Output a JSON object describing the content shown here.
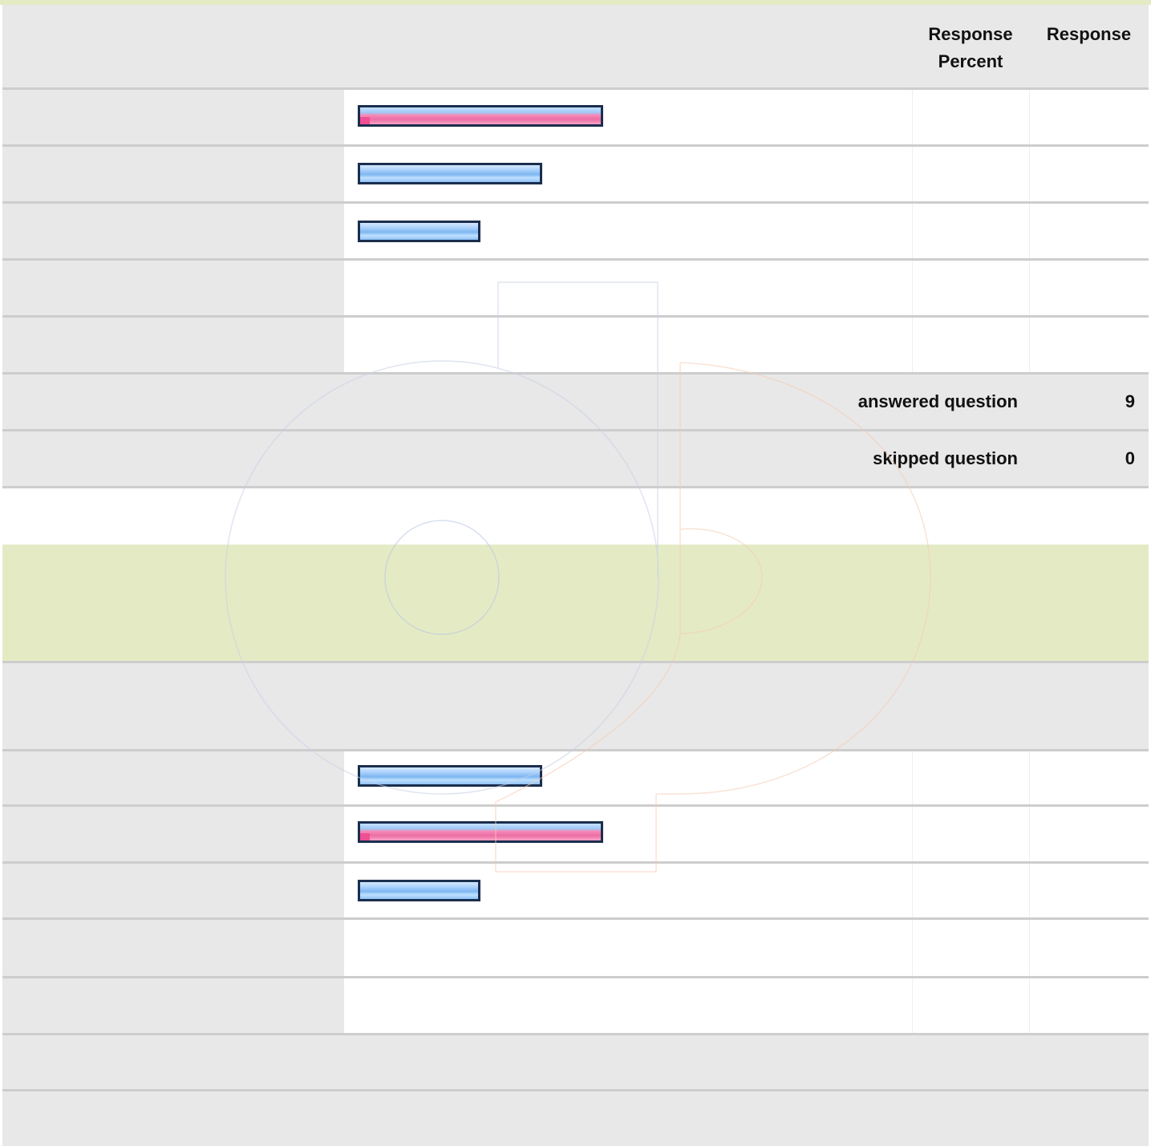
{
  "table1": {
    "header": {
      "response_percent": "Response Percent",
      "response_count": "Response"
    },
    "bars": [
      {
        "percent": 44.4,
        "style": "pink"
      },
      {
        "percent": 33.3,
        "style": "blue"
      },
      {
        "percent": 22.2,
        "style": "blue"
      },
      {
        "percent": 0,
        "style": "none"
      },
      {
        "percent": 0,
        "style": "none"
      }
    ],
    "summary": {
      "answered_label": "answered question",
      "answered_value": "9",
      "skipped_label": "skipped question",
      "skipped_value": "0"
    }
  },
  "table2": {
    "bars": [
      {
        "percent": 33.3,
        "style": "blue"
      },
      {
        "percent": 44.4,
        "style": "pink"
      },
      {
        "percent": 22.2,
        "style": "blue"
      },
      {
        "percent": 0,
        "style": "none"
      },
      {
        "percent": 0,
        "style": "none"
      }
    ]
  },
  "colors": {
    "section_band": "#e4ebc4",
    "row_gray": "#e8e8e8",
    "bar_border": "#1b2e4d",
    "bar_blue": "#8ec2f6",
    "bar_pink": "#ec6ea4"
  }
}
